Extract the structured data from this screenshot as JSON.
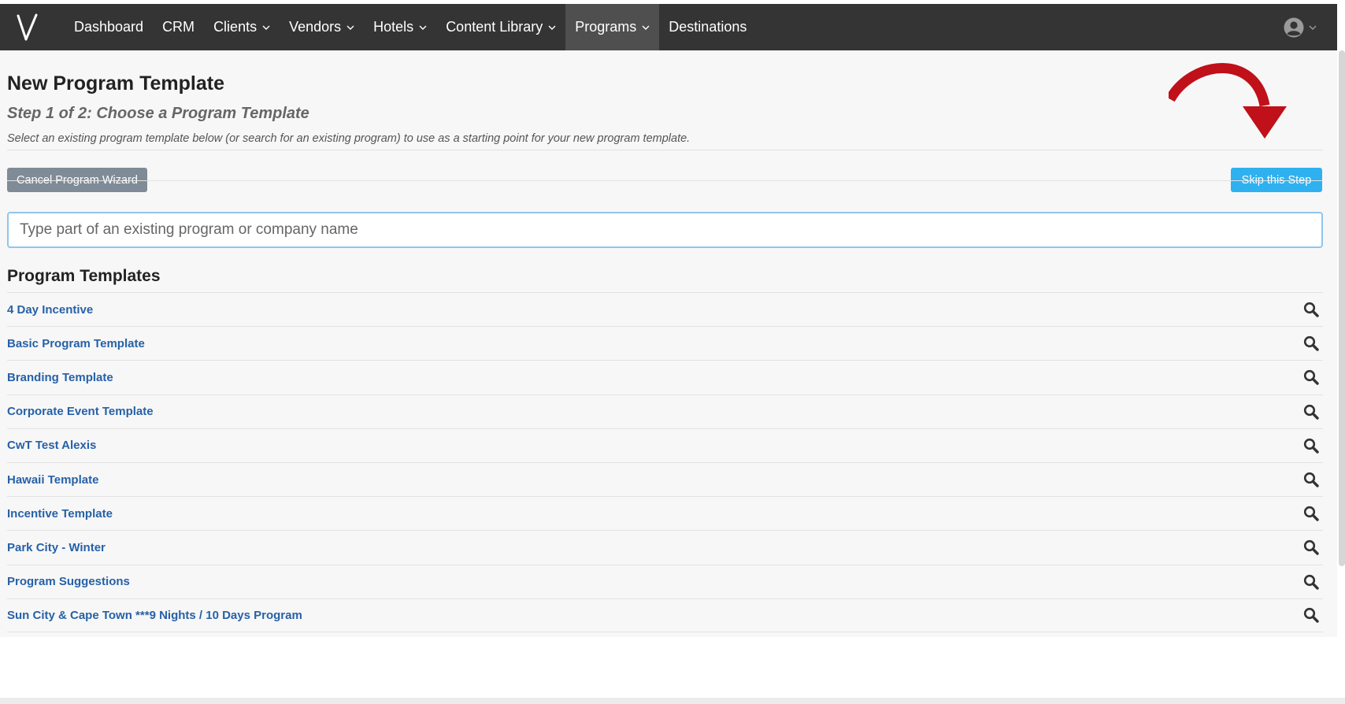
{
  "nav": {
    "brand": "V",
    "items": [
      {
        "label": "Dashboard",
        "dropdown": false,
        "active": false
      },
      {
        "label": "CRM",
        "dropdown": false,
        "active": false
      },
      {
        "label": "Clients",
        "dropdown": true,
        "active": false
      },
      {
        "label": "Vendors",
        "dropdown": true,
        "active": false
      },
      {
        "label": "Hotels",
        "dropdown": true,
        "active": false
      },
      {
        "label": "Content Library",
        "dropdown": true,
        "active": false
      },
      {
        "label": "Programs",
        "dropdown": true,
        "active": true
      },
      {
        "label": "Destinations",
        "dropdown": false,
        "active": false
      }
    ],
    "user_icon": "user-circle-icon"
  },
  "page": {
    "title": "New Program Template",
    "subtitle": "Step 1 of 2: Choose a Program Template",
    "description": "Select an existing program template below (or search for an existing program) to use as a starting point for your new program template."
  },
  "actions": {
    "cancel_label": "Cancel Program Wizard",
    "skip_label": "Skip this Step"
  },
  "search": {
    "placeholder": "Type part of an existing program or company name",
    "value": ""
  },
  "templates": {
    "heading": "Program Templates",
    "items": [
      "4 Day Incentive",
      "Basic Program Template",
      "Branding Template",
      "Corporate Event Template",
      "CwT Test Alexis",
      "Hawaii Template",
      "Incentive Template",
      "Park City - Winter",
      "Program Suggestions",
      "Sun City & Cape Town ***9 Nights / 10 Days Program"
    ],
    "row_icon": "magnifier-icon"
  },
  "colors": {
    "navbar": "#343434",
    "nav_active": "#4f4f4f",
    "link": "#2661a8",
    "cancel_button": "#7f8b97",
    "skip_button": "#2fb1f0",
    "annotation_arrow": "#c0101a"
  }
}
